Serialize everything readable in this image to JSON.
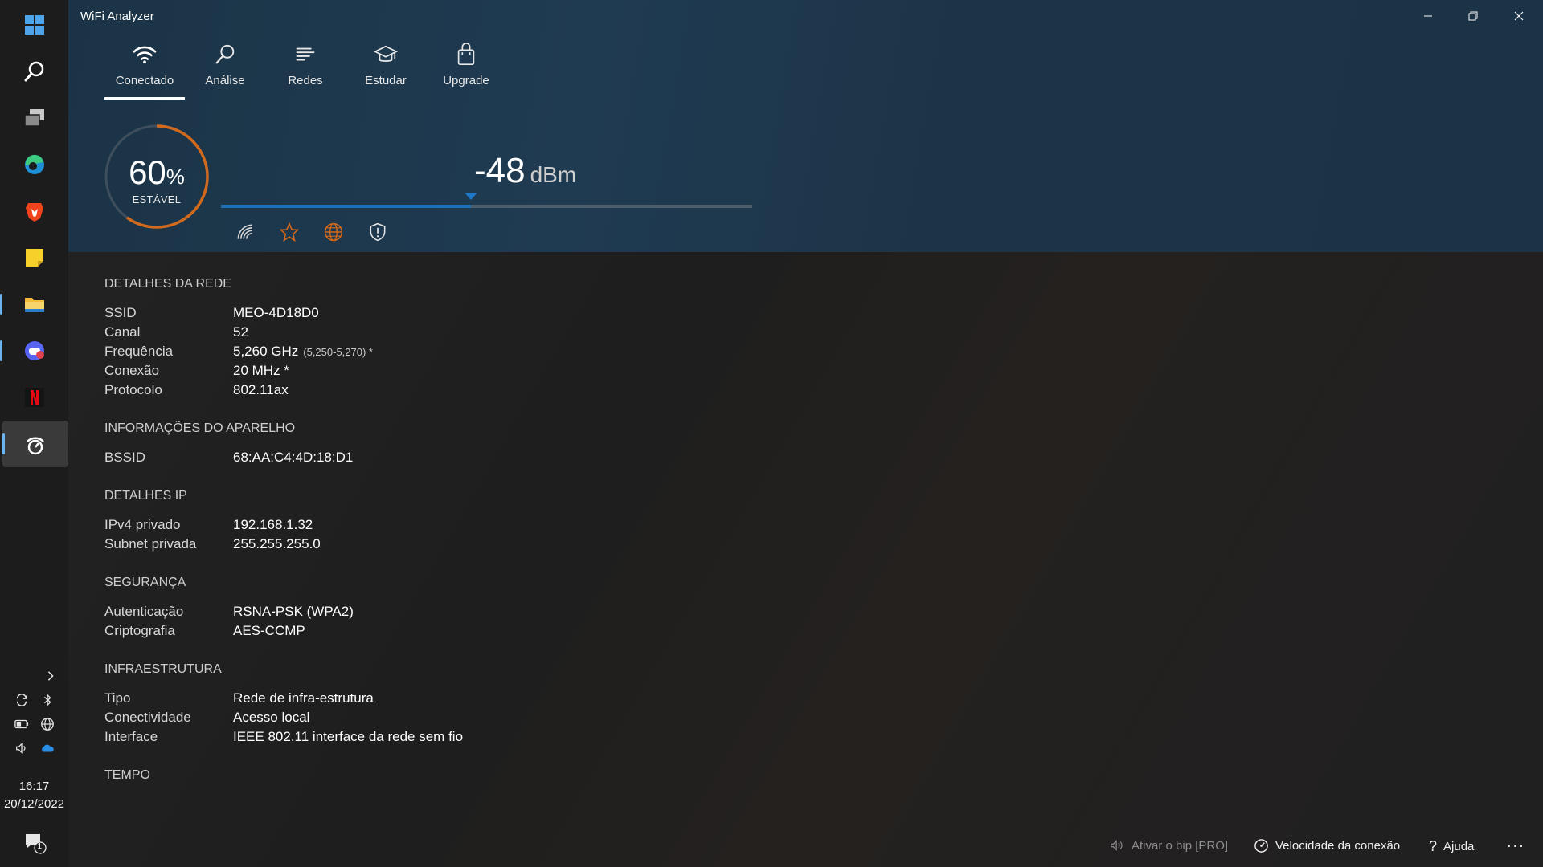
{
  "app": {
    "title": "WiFi Analyzer"
  },
  "tabs": [
    {
      "label": "Conectado",
      "icon": "wifi-icon",
      "active": true
    },
    {
      "label": "Análise",
      "icon": "magnifier-icon"
    },
    {
      "label": "Redes",
      "icon": "list-icon"
    },
    {
      "label": "Estudar",
      "icon": "graduation-cap-icon"
    },
    {
      "label": "Upgrade",
      "icon": "shopping-bag-icon"
    }
  ],
  "signal": {
    "quality_value": "60",
    "quality_unit": "%",
    "quality_fraction": 0.6,
    "status": "ESTÁVEL",
    "dbm_value": "-48",
    "dbm_unit": "dBm",
    "bar_fraction": 0.47
  },
  "sections": {
    "network": {
      "title": "DETALHES DA REDE",
      "ssid_k": "SSID",
      "ssid_v": "MEO-4D18D0",
      "channel_k": "Canal",
      "channel_v": "52",
      "freq_k": "Frequência",
      "freq_v": "5,260 GHz",
      "freq_range": "(5,250-5,270) *",
      "conn_k": "Conexão",
      "conn_v": "20 MHz *",
      "proto_k": "Protocolo",
      "proto_v": "802.11ax"
    },
    "device": {
      "title": "INFORMAÇÕES DO APARELHO",
      "bssid_k": "BSSID",
      "bssid_v": "68:AA:C4:4D:18:D1"
    },
    "ip": {
      "title": "DETALHES IP",
      "ipv4_k": "IPv4 privado",
      "ipv4_v": "192.168.1.32",
      "subnet_k": "Subnet privada",
      "subnet_v": "255.255.255.0"
    },
    "security": {
      "title": "SEGURANÇA",
      "auth_k": "Autenticação",
      "auth_v": "RSNA-PSK (WPA2)",
      "crypto_k": "Criptografia",
      "crypto_v": "AES-CCMP"
    },
    "infra": {
      "title": "INFRAESTRUTURA",
      "type_k": "Tipo",
      "type_v": "Rede de infra-estrutura",
      "conn_k": "Conectividade",
      "conn_v": "Acesso local",
      "iface_k": "Interface",
      "iface_v": "IEEE 802.11 interface da rede sem fio"
    },
    "time": {
      "title": "TEMPO"
    }
  },
  "footer": {
    "beep": "Ativar o bip [PRO]",
    "speed": "Velocidade da conexão",
    "help": "Ajuda",
    "more": "..."
  },
  "taskbar": {
    "time": "16:17",
    "date": "20/12/2022",
    "notification_count": "1"
  },
  "colors": {
    "accent_orange": "#d26a1e",
    "signal_blue": "#1e6fb5",
    "header_band": "#1f3b52"
  }
}
